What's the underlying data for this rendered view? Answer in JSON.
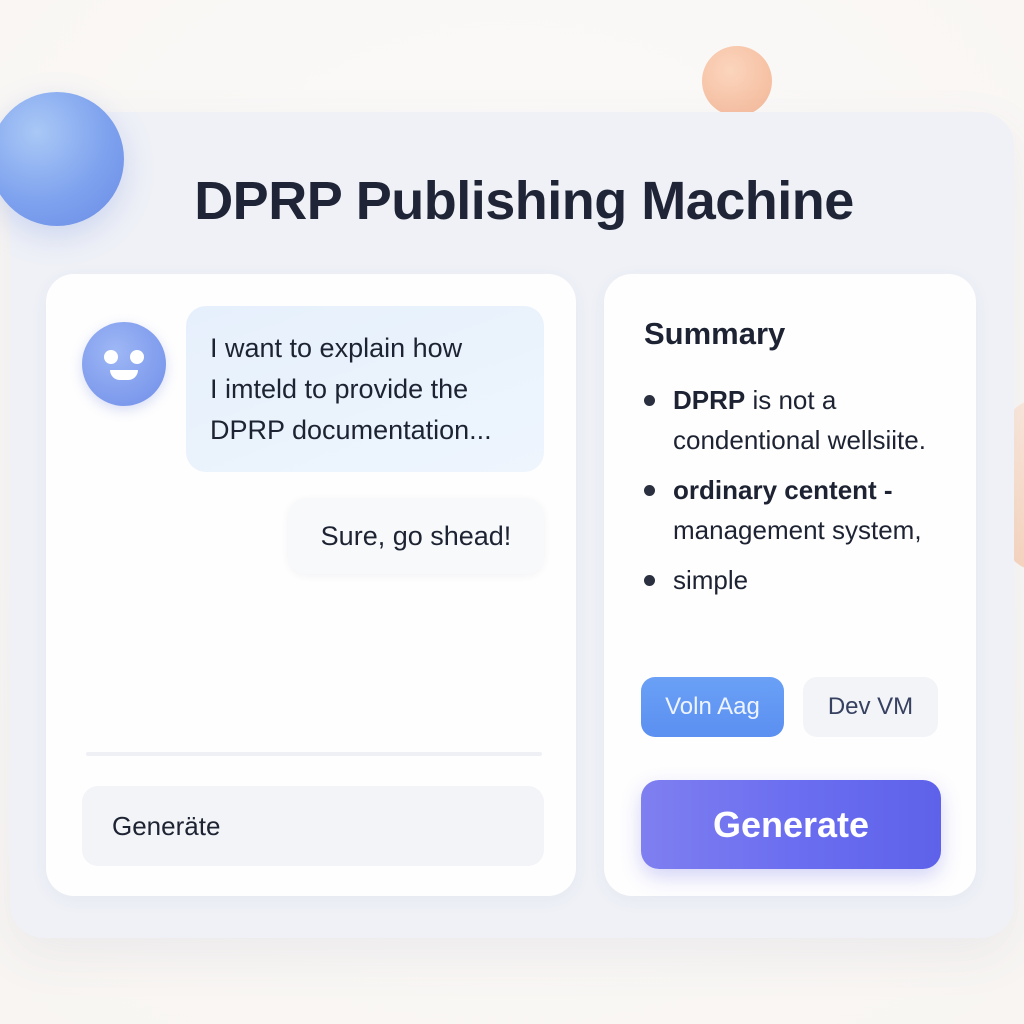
{
  "app": {
    "title": "DPRP Publishing Machine"
  },
  "chat": {
    "user_message_lines": [
      "I want to explain how",
      "I imteld to provide the",
      "DPRP documentation..."
    ],
    "bot_reply": "Sure, go shead!",
    "input_value": "Generäte"
  },
  "summary": {
    "title": "Summary",
    "bullets": [
      {
        "bold": "DPRP",
        "text": " is not a condentional wellsiite."
      },
      {
        "bold": "ordinary centent -",
        "text": " management system,"
      },
      {
        "bold": "",
        "text": "simple"
      }
    ],
    "tags": {
      "primary": "Voln Aag",
      "secondary": "Dev VM"
    },
    "generate_label": "Generate"
  },
  "colors": {
    "accent": "#6b6ef0",
    "tag_blue": "#5b8ff1",
    "panel": "#eff1f7"
  },
  "icons": {
    "avatar": "smiley-bot-icon"
  }
}
